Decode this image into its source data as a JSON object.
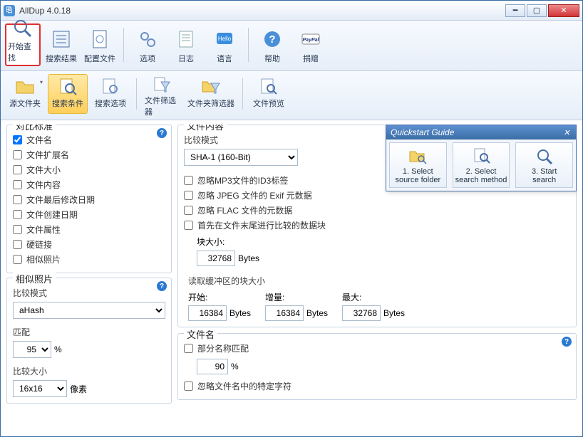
{
  "window": {
    "title": "AllDup 4.0.18"
  },
  "toolbar": [
    {
      "id": "start-search",
      "label": "开始查找"
    },
    {
      "id": "search-results",
      "label": "搜索结果"
    },
    {
      "id": "config",
      "label": "配置文件"
    },
    {
      "id": "options",
      "label": "选项"
    },
    {
      "id": "log",
      "label": "日志"
    },
    {
      "id": "language",
      "label": "语言"
    },
    {
      "id": "help",
      "label": "帮助"
    },
    {
      "id": "donate",
      "label": "捐赠"
    }
  ],
  "subtoolbar": [
    {
      "id": "source-folders",
      "label": "源文件夹"
    },
    {
      "id": "search-criteria",
      "label": "搜索条件"
    },
    {
      "id": "search-options",
      "label": "搜索选项"
    },
    {
      "id": "file-filter",
      "label": "文件筛选器"
    },
    {
      "id": "folder-filter",
      "label": "文件夹筛选器"
    },
    {
      "id": "file-preview",
      "label": "文件预览"
    }
  ],
  "compare": {
    "legend": "对比标准",
    "items": [
      {
        "id": "filename",
        "label": "文件名",
        "checked": true
      },
      {
        "id": "ext",
        "label": "文件扩展名",
        "checked": false
      },
      {
        "id": "size",
        "label": "文件大小",
        "checked": false
      },
      {
        "id": "content",
        "label": "文件内容",
        "checked": false
      },
      {
        "id": "mdate",
        "label": "文件最后修改日期",
        "checked": false
      },
      {
        "id": "cdate",
        "label": "文件创建日期",
        "checked": false
      },
      {
        "id": "attr",
        "label": "文件属性",
        "checked": false
      },
      {
        "id": "hardlink",
        "label": "硬链接",
        "checked": false
      },
      {
        "id": "similar",
        "label": "相似照片",
        "checked": false
      }
    ]
  },
  "similar": {
    "legend": "相似照片",
    "mode_label": "比较模式",
    "mode_value": "aHash",
    "match_label": "匹配",
    "match_value": "95",
    "pct": "%",
    "size_label": "比较大小",
    "size_value": "16x16",
    "px_label": "像素"
  },
  "filecontent": {
    "legend": "文件内容",
    "mode_label": "比较模式",
    "mode_value": "SHA-1 (160-Bit)",
    "ignore_id3": "忽略MP3文件的ID3标签",
    "ignore_exif": "忽略 JPEG 文件的 Exif 元数据",
    "ignore_flac": "忽略 FLAC 文件的元数据",
    "tail_first": "首先在文件末尾进行比较的数据块",
    "block_label": "块大小:",
    "block_value": "32768",
    "buffer_label": "读取缓冲区的块大小",
    "start_label": "开始:",
    "start_value": "16384",
    "inc_label": "增量:",
    "inc_value": "16384",
    "max_label": "最大:",
    "max_value": "32768",
    "bytes": "Bytes"
  },
  "filename": {
    "legend": "文件名",
    "partial": "部分名称匹配",
    "partial_value": "90",
    "pct": "%",
    "ignore_chars": "忽略文件名中的特定字符"
  },
  "quickstart": {
    "title": "Quickstart Guide",
    "steps": [
      {
        "id": "s1",
        "line1": "1. Select",
        "line2": "source folder"
      },
      {
        "id": "s2",
        "line1": "2. Select",
        "line2": "search method"
      },
      {
        "id": "s3",
        "line1": "3. Start",
        "line2": "search"
      }
    ]
  }
}
